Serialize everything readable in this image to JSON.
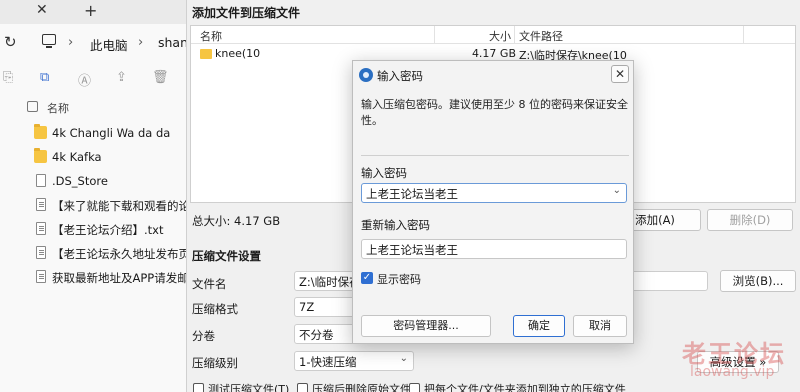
{
  "explorer": {
    "tab_close": "✕",
    "tab_new": "+",
    "breadcrumb": [
      "此电脑",
      "shan"
    ],
    "header_name": "名称",
    "files": [
      {
        "name": "4k Changli Wa da da",
        "type": "folder"
      },
      {
        "name": "4k Kafka",
        "type": "folder"
      },
      {
        "name": ".DS_Store",
        "type": "file"
      },
      {
        "name": "【来了就能下载和观看的论坛,",
        "type": "file"
      },
      {
        "name": "【老王论坛介绍】.txt",
        "type": "file"
      },
      {
        "name": "【老王论坛永久地址发布页】.t",
        "type": "file"
      },
      {
        "name": "获取最新地址及APP请发邮箱自",
        "type": "file"
      }
    ]
  },
  "archive": {
    "title": "添加文件到压缩文件",
    "columns": {
      "name": "名称",
      "size": "大小",
      "path": "文件路径"
    },
    "rows": [
      {
        "name": "knee(10",
        "size": "4.17 GB",
        "path": "Z:\\临时保存\\knee(10"
      }
    ],
    "total_size": "总大小: 4.17 GB",
    "add_button": "添加(A)",
    "delete_button": "删除(D)",
    "settings_title": "压缩文件设置",
    "labels": {
      "filename": "文件名",
      "format": "压缩格式",
      "split": "分卷",
      "level": "压缩级别"
    },
    "values": {
      "filename": "Z:\\临时保存\\",
      "format": "7Z",
      "split": "不分卷",
      "level": "1-快速压缩"
    },
    "browse_button": "浏览(B)...",
    "advanced_button": "高级设置 »",
    "checkboxes": [
      "测试压缩文件(T)",
      "压缩后删除原始文件",
      "把每个文件/文件夹添加到独立的压缩文件"
    ]
  },
  "password_dialog": {
    "title": "输入密码",
    "close": "✕",
    "description": "输入压缩包密码。建议使用至少 8 位的密码来保证安全性。",
    "password_label": "输入密码",
    "password_value": "上老王论坛当老王",
    "confirm_label": "重新输入密码",
    "confirm_value": "上老王论坛当老王",
    "show_password_label": "显示密码",
    "show_password_checked": true,
    "manager_button": "密码管理器...",
    "ok_button": "确定",
    "cancel_button": "取消"
  },
  "watermark": {
    "text_cn": "老王论坛",
    "text_en": "laowang.vip"
  },
  "icons": {
    "refresh": "↻",
    "chevron_right": "›",
    "chevron_down": "⌄",
    "toolbar": [
      "⎘",
      "⧉",
      "Ⓐ",
      "⇪",
      "🗑"
    ],
    "check": "✓"
  },
  "colors": {
    "accent": "#2f6fd2",
    "folder": "#f6c542",
    "watermark": "#d64949"
  }
}
